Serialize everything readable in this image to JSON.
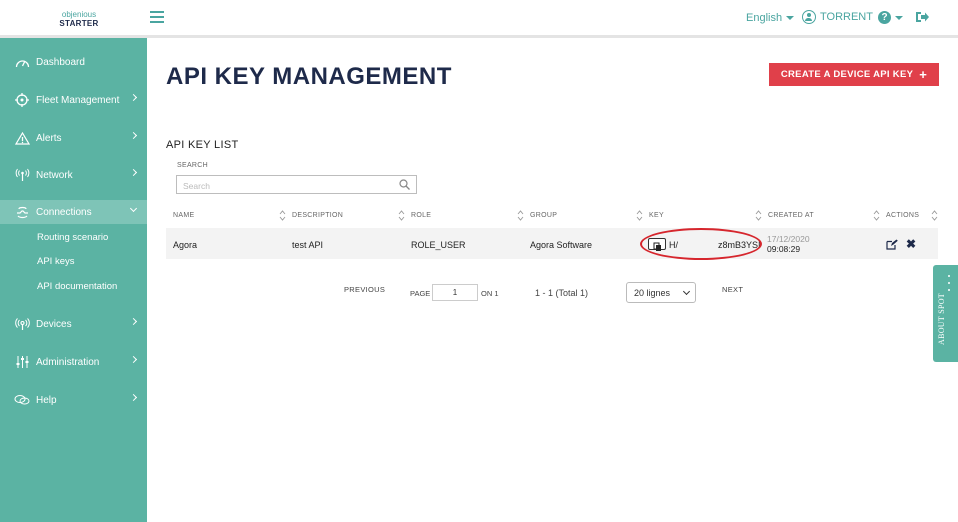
{
  "header": {
    "logo_line1": "objenious",
    "logo_line2": "STARTER",
    "language": "English",
    "user": "TORRENT"
  },
  "sidebar": {
    "items": [
      {
        "label": "Dashboard",
        "icon": "gauge-icon"
      },
      {
        "label": "Fleet Management",
        "icon": "crosshair-icon"
      },
      {
        "label": "Alerts",
        "icon": "warning-icon"
      },
      {
        "label": "Network",
        "icon": "antenna-icon"
      },
      {
        "label": "Connections",
        "icon": "plug-icon"
      },
      {
        "label": "Devices",
        "icon": "broadcast-icon"
      },
      {
        "label": "Administration",
        "icon": "sliders-icon"
      },
      {
        "label": "Help",
        "icon": "chat-icon"
      }
    ],
    "sub_items": [
      "Routing scenario",
      "API keys",
      "API documentation"
    ]
  },
  "main": {
    "title": "API KEY MANAGEMENT",
    "create_button": "CREATE A DEVICE API KEY",
    "list_title": "API KEY LIST",
    "search_label": "SEARCH",
    "search_placeholder": "Search",
    "columns": [
      "NAME",
      "DESCRIPTION",
      "ROLE",
      "GROUP",
      "KEY",
      "CREATED AT",
      "ACTIONS"
    ],
    "row": {
      "name": "Agora",
      "description": "test API",
      "role": "ROLE_USER",
      "group": "Agora Software",
      "key_start": "H/",
      "key_end": "z8mB3YSI",
      "created_date": "17/12/2020",
      "created_time": "09:08:29"
    }
  },
  "pagination": {
    "previous": "PREVIOUS",
    "page_label": "PAGE",
    "page_value": "1",
    "on_label": "ON 1",
    "total": "1 - 1 (Total 1)",
    "per_page": "20 lignes",
    "next": "NEXT"
  },
  "about_tab": "ABOUT SPOT",
  "colors": {
    "sidebar": "#5bb3a3",
    "accent": "#4aa5a0",
    "danger": "#e0404a",
    "title": "#1e2a4a",
    "highlight_circle": "#d6262d"
  }
}
